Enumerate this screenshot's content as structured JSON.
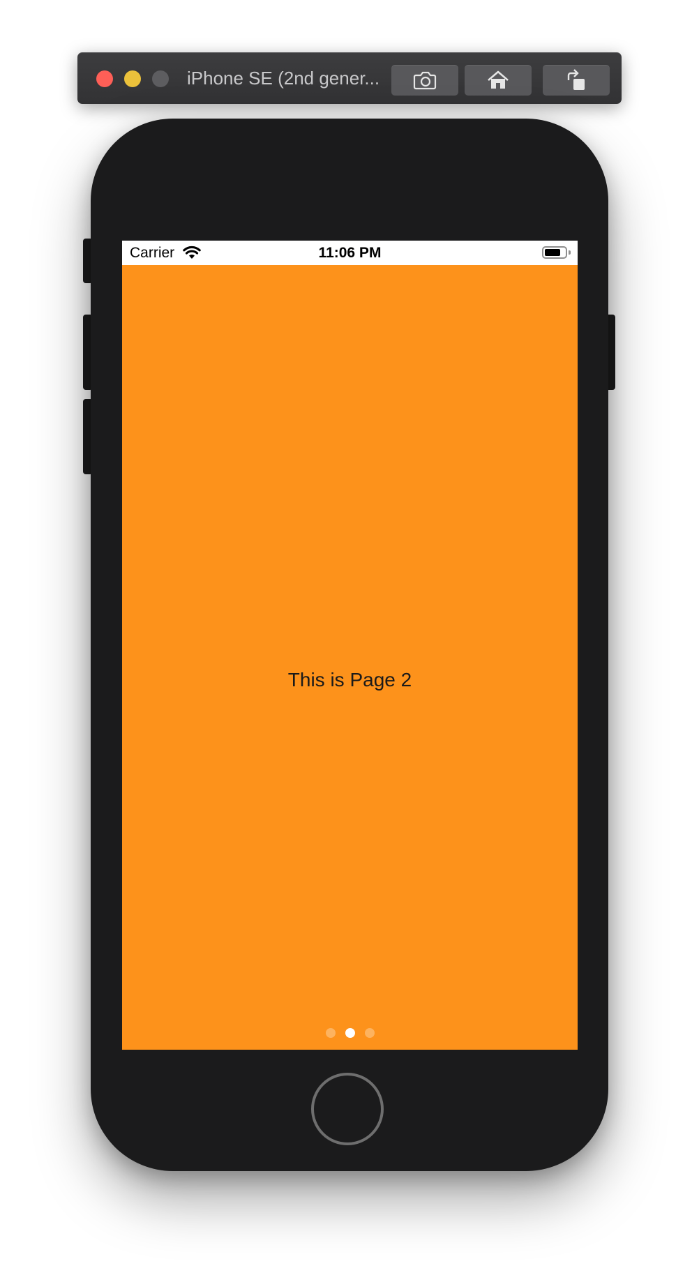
{
  "simulator": {
    "title": "iPhone SE (2nd gener...",
    "traffic_lights": {
      "close_color": "#fe5f57",
      "minimize_color": "#ebc13b",
      "zoom_color": "#5d5d60"
    },
    "toolbar_buttons": [
      {
        "name": "screenshot",
        "icon": "camera-icon"
      },
      {
        "name": "home",
        "icon": "home-icon"
      },
      {
        "name": "rotate",
        "icon": "rotate-icon"
      }
    ]
  },
  "device": {
    "body_color": "#1b1b1c"
  },
  "status_bar": {
    "carrier": "Carrier",
    "time": "11:06 PM",
    "wifi_icon": "wifi-icon",
    "battery_icon": "battery-icon",
    "battery_level": 0.8
  },
  "page": {
    "background_color": "#fd921b",
    "label": "This is Page 2",
    "page_count": 3,
    "current_page": 2
  }
}
